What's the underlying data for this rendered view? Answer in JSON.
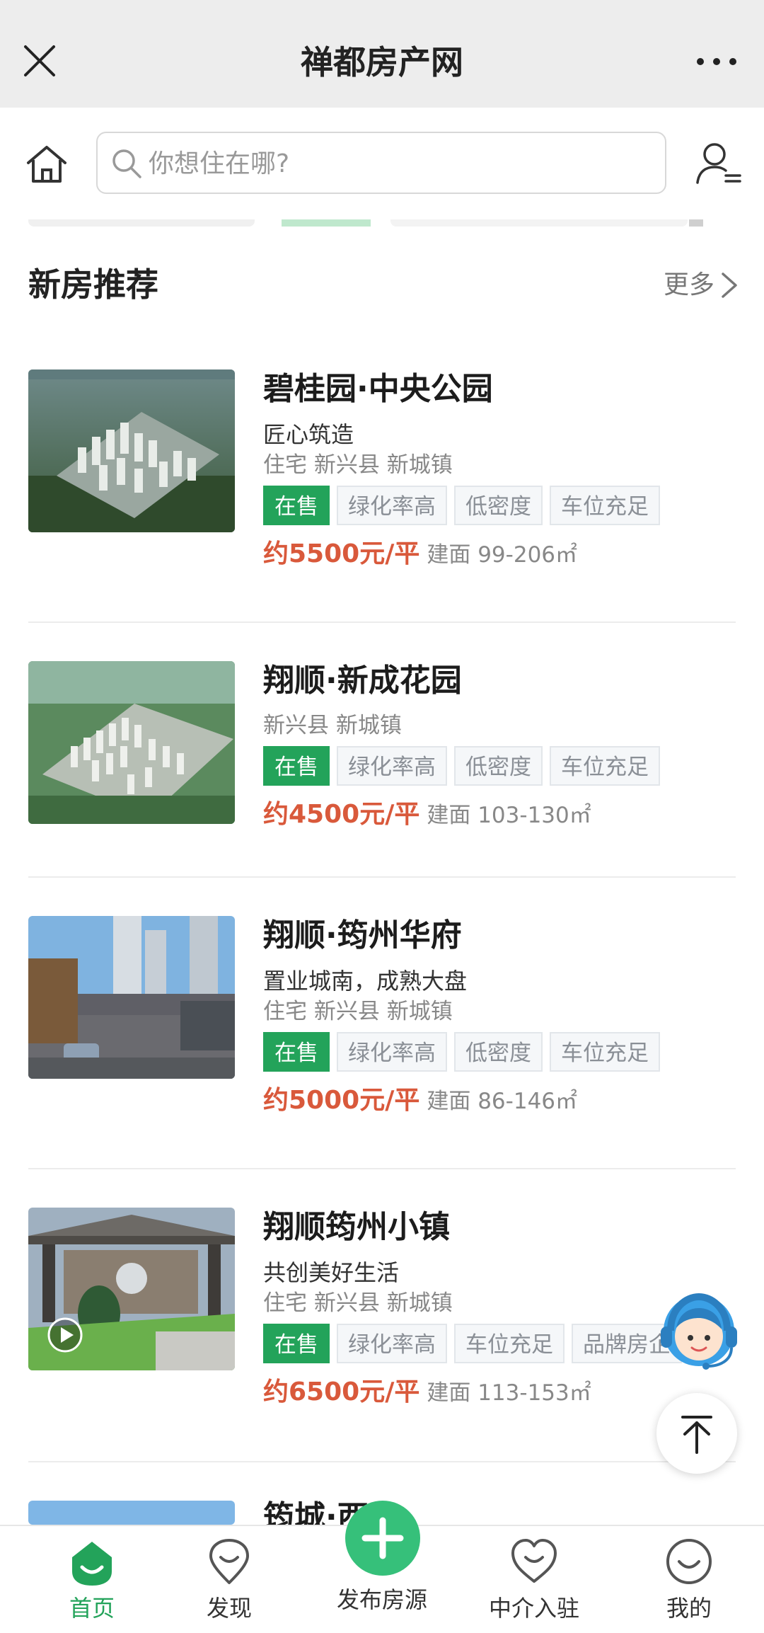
{
  "window": {
    "title": "禅都房产网"
  },
  "search": {
    "placeholder": "你想住在哪?"
  },
  "section": {
    "title": "新房推荐",
    "more_label": "更多"
  },
  "listings": [
    {
      "name": "碧桂园·中央公园",
      "slogan": "匠心筑造",
      "location": "住宅 新兴县 新城镇",
      "status": "在售",
      "tags": [
        "绿化率高",
        "低密度",
        "车位充足"
      ],
      "price": "约5500元/平",
      "area": "建面 99-206㎡"
    },
    {
      "name": "翔顺·新成花园",
      "slogan": "",
      "location": "新兴县 新城镇",
      "status": "在售",
      "tags": [
        "绿化率高",
        "低密度",
        "车位充足"
      ],
      "price": "约4500元/平",
      "area": "建面 103-130㎡"
    },
    {
      "name": "翔顺·筠州华府",
      "slogan": "置业城南，成熟大盘",
      "location": "住宅 新兴县 新城镇",
      "status": "在售",
      "tags": [
        "绿化率高",
        "低密度",
        "车位充足"
      ],
      "price": "约5000元/平",
      "area": "建面 86-146㎡"
    },
    {
      "name": "翔顺筠州小镇",
      "slogan": "共创美好生活",
      "location": "住宅 新兴县 新城镇",
      "status": "在售",
      "tags": [
        "绿化率高",
        "车位充足",
        "品牌房企"
      ],
      "price": "约6500元/平",
      "area": "建面 113-153㎡"
    },
    {
      "name": "筠城·西",
      "slogan": "",
      "location": "",
      "status": "",
      "tags": [],
      "price": "",
      "area": ""
    }
  ],
  "nav": {
    "home": "首页",
    "discover": "发现",
    "publish": "发布房源",
    "agent": "中介入驻",
    "mine": "我的"
  },
  "colors": {
    "accent_green": "#23a35a",
    "fab_green": "#36c07a",
    "price_red": "#d9593b",
    "cs_blue": "#3aa0e6"
  }
}
